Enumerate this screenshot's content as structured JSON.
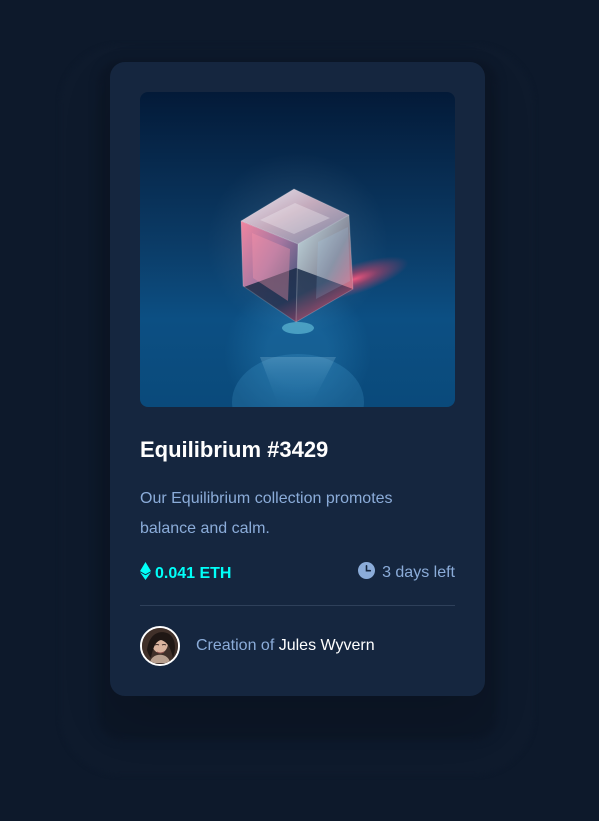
{
  "card": {
    "title": "Equilibrium #3429",
    "description": "Our Equilibrium collection promotes balance and calm.",
    "price": "0.041 ETH",
    "time_left": "3 days left",
    "creator_prefix": "Creation of",
    "creator_name": "Jules Wyvern"
  },
  "colors": {
    "background": "#0d192b",
    "card": "#15263f",
    "accent": "#00fff8",
    "muted": "#8bacd9",
    "white": "#ffffff"
  },
  "icons": {
    "price": "ethereum-icon",
    "time": "clock-icon",
    "creator": "avatar"
  }
}
